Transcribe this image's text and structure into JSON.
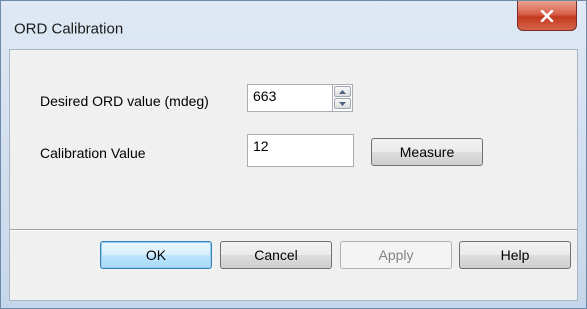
{
  "window": {
    "title": "ORD Calibration",
    "close_icon": "close-icon"
  },
  "fields": {
    "desired_label": "Desired ORD value (mdeg)",
    "desired_value": "663",
    "calibration_label": "Calibration Value",
    "calibration_value": "12"
  },
  "buttons": {
    "measure": "Measure",
    "ok": "OK",
    "cancel": "Cancel",
    "apply": "Apply",
    "help": "Help"
  },
  "colors": {
    "close_button": "#c2391f",
    "default_button_border": "#3c7fb1",
    "window_frame": "#c6d6ea"
  }
}
